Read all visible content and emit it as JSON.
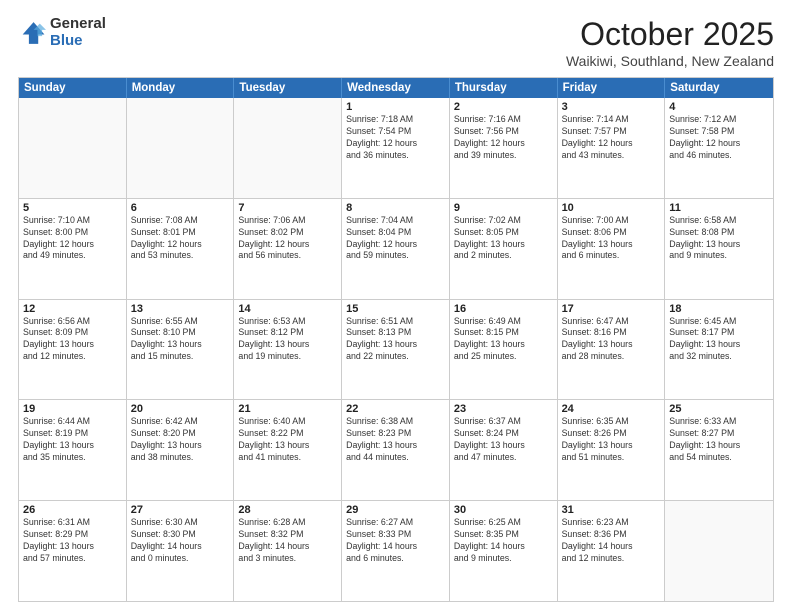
{
  "logo": {
    "general": "General",
    "blue": "Blue"
  },
  "header": {
    "month": "October 2025",
    "location": "Waikiwi, Southland, New Zealand"
  },
  "weekdays": [
    "Sunday",
    "Monday",
    "Tuesday",
    "Wednesday",
    "Thursday",
    "Friday",
    "Saturday"
  ],
  "weeks": [
    [
      {
        "day": "",
        "info": ""
      },
      {
        "day": "",
        "info": ""
      },
      {
        "day": "",
        "info": ""
      },
      {
        "day": "1",
        "info": "Sunrise: 7:18 AM\nSunset: 7:54 PM\nDaylight: 12 hours\nand 36 minutes."
      },
      {
        "day": "2",
        "info": "Sunrise: 7:16 AM\nSunset: 7:56 PM\nDaylight: 12 hours\nand 39 minutes."
      },
      {
        "day": "3",
        "info": "Sunrise: 7:14 AM\nSunset: 7:57 PM\nDaylight: 12 hours\nand 43 minutes."
      },
      {
        "day": "4",
        "info": "Sunrise: 7:12 AM\nSunset: 7:58 PM\nDaylight: 12 hours\nand 46 minutes."
      }
    ],
    [
      {
        "day": "5",
        "info": "Sunrise: 7:10 AM\nSunset: 8:00 PM\nDaylight: 12 hours\nand 49 minutes."
      },
      {
        "day": "6",
        "info": "Sunrise: 7:08 AM\nSunset: 8:01 PM\nDaylight: 12 hours\nand 53 minutes."
      },
      {
        "day": "7",
        "info": "Sunrise: 7:06 AM\nSunset: 8:02 PM\nDaylight: 12 hours\nand 56 minutes."
      },
      {
        "day": "8",
        "info": "Sunrise: 7:04 AM\nSunset: 8:04 PM\nDaylight: 12 hours\nand 59 minutes."
      },
      {
        "day": "9",
        "info": "Sunrise: 7:02 AM\nSunset: 8:05 PM\nDaylight: 13 hours\nand 2 minutes."
      },
      {
        "day": "10",
        "info": "Sunrise: 7:00 AM\nSunset: 8:06 PM\nDaylight: 13 hours\nand 6 minutes."
      },
      {
        "day": "11",
        "info": "Sunrise: 6:58 AM\nSunset: 8:08 PM\nDaylight: 13 hours\nand 9 minutes."
      }
    ],
    [
      {
        "day": "12",
        "info": "Sunrise: 6:56 AM\nSunset: 8:09 PM\nDaylight: 13 hours\nand 12 minutes."
      },
      {
        "day": "13",
        "info": "Sunrise: 6:55 AM\nSunset: 8:10 PM\nDaylight: 13 hours\nand 15 minutes."
      },
      {
        "day": "14",
        "info": "Sunrise: 6:53 AM\nSunset: 8:12 PM\nDaylight: 13 hours\nand 19 minutes."
      },
      {
        "day": "15",
        "info": "Sunrise: 6:51 AM\nSunset: 8:13 PM\nDaylight: 13 hours\nand 22 minutes."
      },
      {
        "day": "16",
        "info": "Sunrise: 6:49 AM\nSunset: 8:15 PM\nDaylight: 13 hours\nand 25 minutes."
      },
      {
        "day": "17",
        "info": "Sunrise: 6:47 AM\nSunset: 8:16 PM\nDaylight: 13 hours\nand 28 minutes."
      },
      {
        "day": "18",
        "info": "Sunrise: 6:45 AM\nSunset: 8:17 PM\nDaylight: 13 hours\nand 32 minutes."
      }
    ],
    [
      {
        "day": "19",
        "info": "Sunrise: 6:44 AM\nSunset: 8:19 PM\nDaylight: 13 hours\nand 35 minutes."
      },
      {
        "day": "20",
        "info": "Sunrise: 6:42 AM\nSunset: 8:20 PM\nDaylight: 13 hours\nand 38 minutes."
      },
      {
        "day": "21",
        "info": "Sunrise: 6:40 AM\nSunset: 8:22 PM\nDaylight: 13 hours\nand 41 minutes."
      },
      {
        "day": "22",
        "info": "Sunrise: 6:38 AM\nSunset: 8:23 PM\nDaylight: 13 hours\nand 44 minutes."
      },
      {
        "day": "23",
        "info": "Sunrise: 6:37 AM\nSunset: 8:24 PM\nDaylight: 13 hours\nand 47 minutes."
      },
      {
        "day": "24",
        "info": "Sunrise: 6:35 AM\nSunset: 8:26 PM\nDaylight: 13 hours\nand 51 minutes."
      },
      {
        "day": "25",
        "info": "Sunrise: 6:33 AM\nSunset: 8:27 PM\nDaylight: 13 hours\nand 54 minutes."
      }
    ],
    [
      {
        "day": "26",
        "info": "Sunrise: 6:31 AM\nSunset: 8:29 PM\nDaylight: 13 hours\nand 57 minutes."
      },
      {
        "day": "27",
        "info": "Sunrise: 6:30 AM\nSunset: 8:30 PM\nDaylight: 14 hours\nand 0 minutes."
      },
      {
        "day": "28",
        "info": "Sunrise: 6:28 AM\nSunset: 8:32 PM\nDaylight: 14 hours\nand 3 minutes."
      },
      {
        "day": "29",
        "info": "Sunrise: 6:27 AM\nSunset: 8:33 PM\nDaylight: 14 hours\nand 6 minutes."
      },
      {
        "day": "30",
        "info": "Sunrise: 6:25 AM\nSunset: 8:35 PM\nDaylight: 14 hours\nand 9 minutes."
      },
      {
        "day": "31",
        "info": "Sunrise: 6:23 AM\nSunset: 8:36 PM\nDaylight: 14 hours\nand 12 minutes."
      },
      {
        "day": "",
        "info": ""
      }
    ]
  ]
}
